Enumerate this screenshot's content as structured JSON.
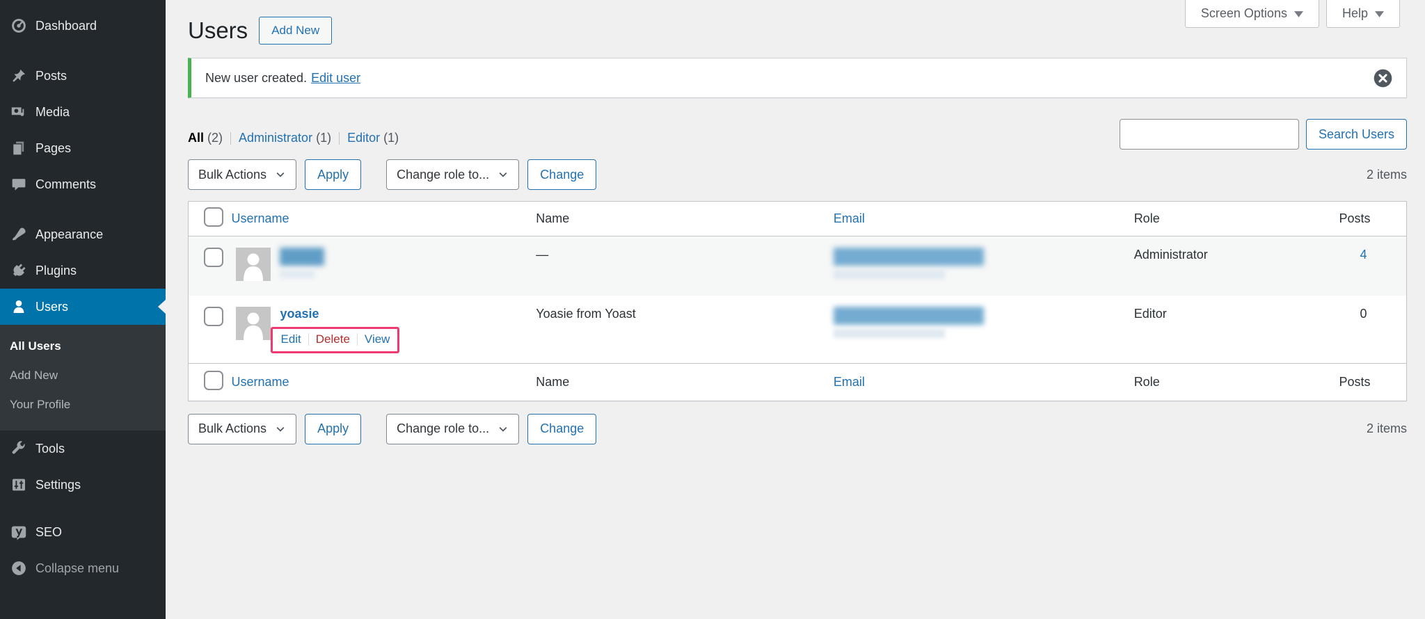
{
  "colors": {
    "accent": "#2271b1",
    "menu_active_bg": "#0073aa",
    "sidebar_bg": "#23282d",
    "submenu_bg": "#32373c",
    "content_bg": "#f0f0f1",
    "notice_green": "#46b450",
    "delete_red": "#b32d2e",
    "highlight_pink": "#ee3a70"
  },
  "sidebar": {
    "items": [
      {
        "label": "Dashboard"
      },
      {
        "label": "Posts"
      },
      {
        "label": "Media"
      },
      {
        "label": "Pages"
      },
      {
        "label": "Comments"
      },
      {
        "label": "Appearance"
      },
      {
        "label": "Plugins"
      },
      {
        "label": "Users"
      },
      {
        "label": "Tools"
      },
      {
        "label": "Settings"
      },
      {
        "label": "SEO"
      },
      {
        "label": "Collapse menu"
      }
    ],
    "users_submenu": [
      {
        "label": "All Users"
      },
      {
        "label": "Add New"
      },
      {
        "label": "Your Profile"
      }
    ]
  },
  "header": {
    "title": "Users",
    "add_new_label": "Add New",
    "screen_options_label": "Screen Options",
    "help_label": "Help"
  },
  "notice": {
    "message": "New user created.",
    "link_label": "Edit user"
  },
  "filters": [
    {
      "label": "All",
      "count": "(2)"
    },
    {
      "label": "Administrator",
      "count": "(1)"
    },
    {
      "label": "Editor",
      "count": "(1)"
    }
  ],
  "toolbar": {
    "bulk_actions_label": "Bulk Actions",
    "apply_label": "Apply",
    "change_role_label": "Change role to...",
    "change_label": "Change",
    "search_button_label": "Search Users",
    "search_value": "",
    "items_count": "2 items"
  },
  "table": {
    "columns": [
      "Username",
      "Name",
      "Email",
      "Role",
      "Posts"
    ],
    "rows": [
      {
        "username_blurred": true,
        "name": "—",
        "email_blurred": true,
        "role": "Administrator",
        "posts": "4"
      },
      {
        "username": "yoasie",
        "name": "Yoasie from Yoast",
        "email_blurred": true,
        "role": "Editor",
        "posts": "0",
        "row_actions": [
          {
            "label": "Edit"
          },
          {
            "label": "Delete"
          },
          {
            "label": "View"
          }
        ]
      }
    ]
  }
}
